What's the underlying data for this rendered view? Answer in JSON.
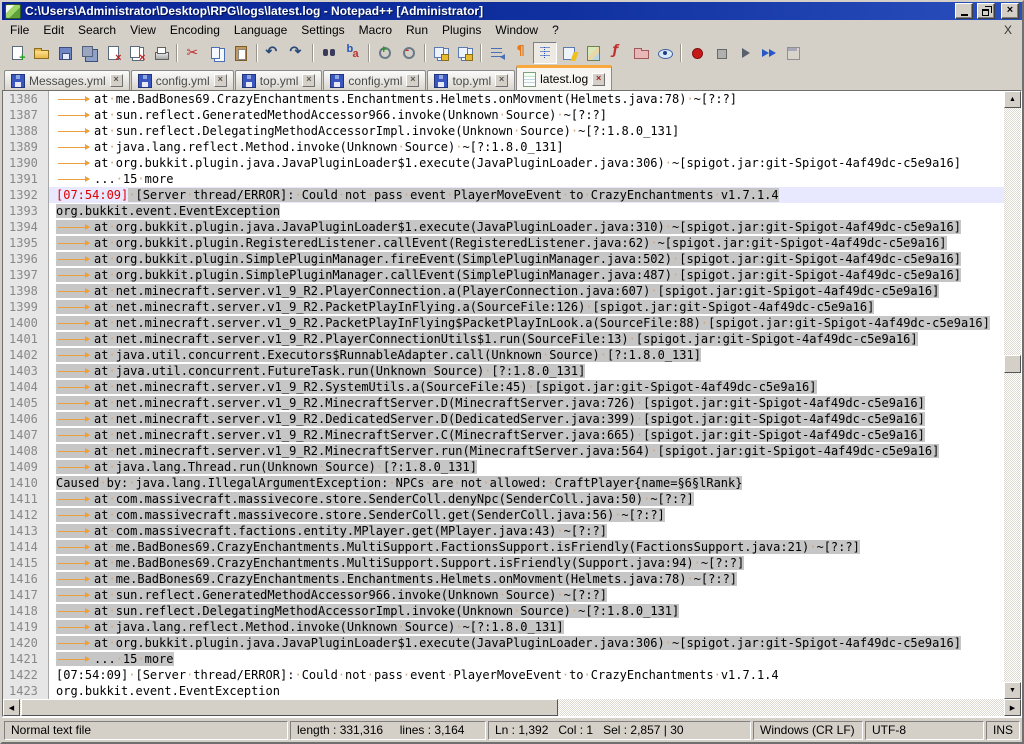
{
  "colors": {
    "selection_gray": "#C6C6C6",
    "current_line_highlight": "#E8E8FF",
    "active_tab_accent": "#F8A83C",
    "error_timestamp_red": "#E00000",
    "whitespace_orange": "#E8A040",
    "titlebar_blue": "#0A2498"
  },
  "window": {
    "title": "C:\\Users\\Administrator\\Desktop\\RPG\\logs\\latest.log - Notepad++ [Administrator]",
    "controls": [
      "minimize",
      "restore",
      "close"
    ]
  },
  "menu": {
    "items": [
      "File",
      "Edit",
      "Search",
      "View",
      "Encoding",
      "Language",
      "Settings",
      "Macro",
      "Run",
      "Plugins",
      "Window",
      "?"
    ],
    "close_label": "X"
  },
  "toolbar": {
    "groups": [
      [
        "new-file",
        "open-file",
        "save-file",
        "save-all",
        "close-file",
        "close-all",
        "print"
      ],
      [
        "cut",
        "copy",
        "paste"
      ],
      [
        "undo",
        "redo"
      ],
      [
        "find",
        "replace"
      ],
      [
        "zoom-in",
        "zoom-out"
      ],
      [
        "sync-vertical-scroll",
        "sync-horizontal-scroll"
      ],
      [
        "word-wrap",
        "show-all-characters",
        "show-indent-guide",
        "user-defined-dialog",
        "document-map",
        "function-list",
        "folder-as-workspace",
        "monitoring"
      ],
      [
        "macro-record",
        "macro-stop",
        "macro-play",
        "macro-run-multiple",
        "macro-save"
      ]
    ],
    "pressed": [
      "show-indent-guide"
    ]
  },
  "tabs": [
    {
      "label": "Messages.yml",
      "active": false
    },
    {
      "label": "config.yml",
      "active": false
    },
    {
      "label": "top.yml",
      "active": false
    },
    {
      "label": "config.yml",
      "active": false
    },
    {
      "label": "top.yml",
      "active": false
    },
    {
      "label": "latest.log",
      "active": true
    }
  ],
  "editor": {
    "lines": [
      {
        "n": 1386,
        "tab": true,
        "sel": false,
        "t": "at me.BadBones69.CrazyEnchantments.Enchantments.Helmets.onMovment(Helmets.java:78) ~[?:?]"
      },
      {
        "n": 1387,
        "tab": true,
        "sel": false,
        "t": "at sun.reflect.GeneratedMethodAccessor966.invoke(Unknown Source) ~[?:?]"
      },
      {
        "n": 1388,
        "tab": true,
        "sel": false,
        "t": "at sun.reflect.DelegatingMethodAccessorImpl.invoke(Unknown Source) ~[?:1.8.0_131]"
      },
      {
        "n": 1389,
        "tab": true,
        "sel": false,
        "t": "at java.lang.reflect.Method.invoke(Unknown Source) ~[?:1.8.0_131]"
      },
      {
        "n": 1390,
        "tab": true,
        "sel": false,
        "t": "at org.bukkit.plugin.java.JavaPluginLoader$1.execute(JavaPluginLoader.java:306) ~[spigot.jar:git-Spigot-4af49dc-c5e9a16]"
      },
      {
        "n": 1391,
        "tab": true,
        "sel": false,
        "t": "... 15 more"
      },
      {
        "n": 1392,
        "cur": true,
        "parts": [
          {
            "t": "[07:54:09]",
            "red": true
          },
          {
            "t": " [Server thread/ERROR]: Could not pass event PlayerMoveEvent to CrazyEnchantments v1.7.1.4",
            "sel": true
          }
        ]
      },
      {
        "n": 1393,
        "tab": false,
        "sel": true,
        "t": "org.bukkit.event.EventException"
      },
      {
        "n": 1394,
        "tab": true,
        "sel": true,
        "t": "at org.bukkit.plugin.java.JavaPluginLoader$1.execute(JavaPluginLoader.java:310) ~[spigot.jar:git-Spigot-4af49dc-c5e9a16]"
      },
      {
        "n": 1395,
        "tab": true,
        "sel": true,
        "t": "at org.bukkit.plugin.RegisteredListener.callEvent(RegisteredListener.java:62) ~[spigot.jar:git-Spigot-4af49dc-c5e9a16]"
      },
      {
        "n": 1396,
        "tab": true,
        "sel": true,
        "t": "at org.bukkit.plugin.SimplePluginManager.fireEvent(SimplePluginManager.java:502) [spigot.jar:git-Spigot-4af49dc-c5e9a16]"
      },
      {
        "n": 1397,
        "tab": true,
        "sel": true,
        "t": "at org.bukkit.plugin.SimplePluginManager.callEvent(SimplePluginManager.java:487) [spigot.jar:git-Spigot-4af49dc-c5e9a16]"
      },
      {
        "n": 1398,
        "tab": true,
        "sel": true,
        "t": "at net.minecraft.server.v1_9_R2.PlayerConnection.a(PlayerConnection.java:607) [spigot.jar:git-Spigot-4af49dc-c5e9a16]"
      },
      {
        "n": 1399,
        "tab": true,
        "sel": true,
        "t": "at net.minecraft.server.v1_9_R2.PacketPlayInFlying.a(SourceFile:126) [spigot.jar:git-Spigot-4af49dc-c5e9a16]"
      },
      {
        "n": 1400,
        "tab": true,
        "sel": true,
        "t": "at net.minecraft.server.v1_9_R2.PacketPlayInFlying$PacketPlayInLook.a(SourceFile:88) [spigot.jar:git-Spigot-4af49dc-c5e9a16]"
      },
      {
        "n": 1401,
        "tab": true,
        "sel": true,
        "t": "at net.minecraft.server.v1_9_R2.PlayerConnectionUtils$1.run(SourceFile:13) [spigot.jar:git-Spigot-4af49dc-c5e9a16]"
      },
      {
        "n": 1402,
        "tab": true,
        "sel": true,
        "t": "at java.util.concurrent.Executors$RunnableAdapter.call(Unknown Source) [?:1.8.0_131]"
      },
      {
        "n": 1403,
        "tab": true,
        "sel": true,
        "t": "at java.util.concurrent.FutureTask.run(Unknown Source) [?:1.8.0_131]"
      },
      {
        "n": 1404,
        "tab": true,
        "sel": true,
        "t": "at net.minecraft.server.v1_9_R2.SystemUtils.a(SourceFile:45) [spigot.jar:git-Spigot-4af49dc-c5e9a16]"
      },
      {
        "n": 1405,
        "tab": true,
        "sel": true,
        "t": "at net.minecraft.server.v1_9_R2.MinecraftServer.D(MinecraftServer.java:726) [spigot.jar:git-Spigot-4af49dc-c5e9a16]"
      },
      {
        "n": 1406,
        "tab": true,
        "sel": true,
        "t": "at net.minecraft.server.v1_9_R2.DedicatedServer.D(DedicatedServer.java:399) [spigot.jar:git-Spigot-4af49dc-c5e9a16]"
      },
      {
        "n": 1407,
        "tab": true,
        "sel": true,
        "t": "at net.minecraft.server.v1_9_R2.MinecraftServer.C(MinecraftServer.java:665) [spigot.jar:git-Spigot-4af49dc-c5e9a16]"
      },
      {
        "n": 1408,
        "tab": true,
        "sel": true,
        "t": "at net.minecraft.server.v1_9_R2.MinecraftServer.run(MinecraftServer.java:564) [spigot.jar:git-Spigot-4af49dc-c5e9a16]"
      },
      {
        "n": 1409,
        "tab": true,
        "sel": true,
        "t": "at java.lang.Thread.run(Unknown Source) [?:1.8.0_131]"
      },
      {
        "n": 1410,
        "tab": false,
        "sel": true,
        "t": "Caused by: java.lang.IllegalArgumentException: NPCs are not allowed: CraftPlayer{name=§6§lRank}"
      },
      {
        "n": 1411,
        "tab": true,
        "sel": true,
        "t": "at com.massivecraft.massivecore.store.SenderColl.denyNpc(SenderColl.java:50) ~[?:?]"
      },
      {
        "n": 1412,
        "tab": true,
        "sel": true,
        "t": "at com.massivecraft.massivecore.store.SenderColl.get(SenderColl.java:56) ~[?:?]"
      },
      {
        "n": 1413,
        "tab": true,
        "sel": true,
        "t": "at com.massivecraft.factions.entity.MPlayer.get(MPlayer.java:43) ~[?:?]"
      },
      {
        "n": 1414,
        "tab": true,
        "sel": true,
        "t": "at me.BadBones69.CrazyEnchantments.MultiSupport.FactionsSupport.isFriendly(FactionsSupport.java:21) ~[?:?]"
      },
      {
        "n": 1415,
        "tab": true,
        "sel": true,
        "t": "at me.BadBones69.CrazyEnchantments.MultiSupport.Support.isFriendly(Support.java:94) ~[?:?]"
      },
      {
        "n": 1416,
        "tab": true,
        "sel": true,
        "t": "at me.BadBones69.CrazyEnchantments.Enchantments.Helmets.onMovment(Helmets.java:78) ~[?:?]"
      },
      {
        "n": 1417,
        "tab": true,
        "sel": true,
        "t": "at sun.reflect.GeneratedMethodAccessor966.invoke(Unknown Source) ~[?:?]"
      },
      {
        "n": 1418,
        "tab": true,
        "sel": true,
        "t": "at sun.reflect.DelegatingMethodAccessorImpl.invoke(Unknown Source) ~[?:1.8.0_131]"
      },
      {
        "n": 1419,
        "tab": true,
        "sel": true,
        "t": "at java.lang.reflect.Method.invoke(Unknown Source) ~[?:1.8.0_131]"
      },
      {
        "n": 1420,
        "tab": true,
        "sel": true,
        "t": "at org.bukkit.plugin.java.JavaPluginLoader$1.execute(JavaPluginLoader.java:306) ~[spigot.jar:git-Spigot-4af49dc-c5e9a16]"
      },
      {
        "n": 1421,
        "tab": true,
        "sel": true,
        "t": "... 15 more"
      },
      {
        "n": 1422,
        "tab": false,
        "sel": false,
        "t": "[07:54:09] [Server thread/ERROR]: Could not pass event PlayerMoveEvent to CrazyEnchantments v1.7.1.4"
      },
      {
        "n": 1423,
        "tab": false,
        "sel": false,
        "t": "org.bukkit.event.EventException"
      }
    ]
  },
  "status_bar": {
    "panels": [
      {
        "id": "doc-type",
        "text": "Normal text file"
      },
      {
        "id": "length-lines",
        "text": "length : 331,316     lines : 3,164"
      },
      {
        "id": "cursor-position",
        "text": "Ln : 1,392   Col : 1   Sel : 2,857 | 30"
      },
      {
        "id": "eol-format",
        "text": "Windows (CR LF)"
      },
      {
        "id": "encoding",
        "text": "UTF-8"
      },
      {
        "id": "insert-mode",
        "text": "INS"
      }
    ]
  }
}
